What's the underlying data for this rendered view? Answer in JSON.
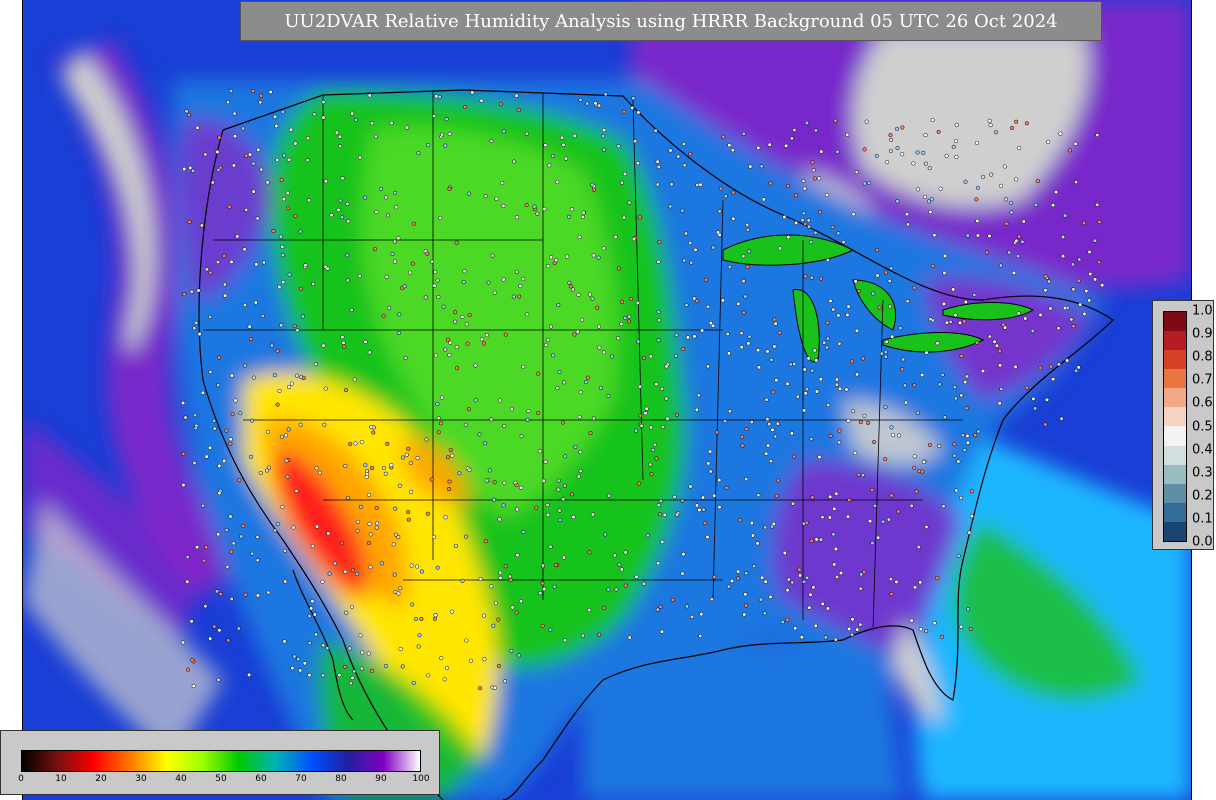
{
  "title": "UU2DVAR Relative Humidity Analysis using HRRR Background 05 UTC 26 Oct 2024",
  "map": {
    "colors": {
      "ocean_deep": "#1a3fd6",
      "ocean_mid": "#1f77e0",
      "cloud": "#cfcfcf",
      "purple": "#8a23c8",
      "green": "#19c21b",
      "light_green": "#58df2a",
      "yellow": "#ffe600",
      "orange": "#ffa500",
      "red": "#ff1a1a",
      "teal": "#19a7c8",
      "cyan": "#1fb6ff",
      "border": "#000000"
    },
    "icons": [
      "observation-station-marker",
      "state-boundary-line",
      "coastline"
    ]
  },
  "rh_colorbar": {
    "ticks": [
      "0",
      "10",
      "20",
      "30",
      "40",
      "50",
      "60",
      "70",
      "80",
      "90",
      "100"
    ],
    "stops": [
      "#000000",
      "#7a1010",
      "#ff0000",
      "#ff7a00",
      "#ffff00",
      "#9aff00",
      "#00c800",
      "#00b4b4",
      "#0050ff",
      "#2020a0",
      "#8000c0",
      "#ffffff"
    ]
  },
  "qc_colorbar": {
    "ticks": [
      "1.0",
      "0.9",
      "0.8",
      "0.7",
      "0.6",
      "0.5",
      "0.4",
      "0.3",
      "0.2",
      "0.1",
      "0.0"
    ],
    "colors": [
      "#7d0a15",
      "#b41d22",
      "#d44028",
      "#e7773e",
      "#f2aa86",
      "#f7d4c2",
      "#f3f3f3",
      "#d2dedf",
      "#99bcc0",
      "#5f8ea5",
      "#336e98",
      "#1a4573"
    ]
  }
}
